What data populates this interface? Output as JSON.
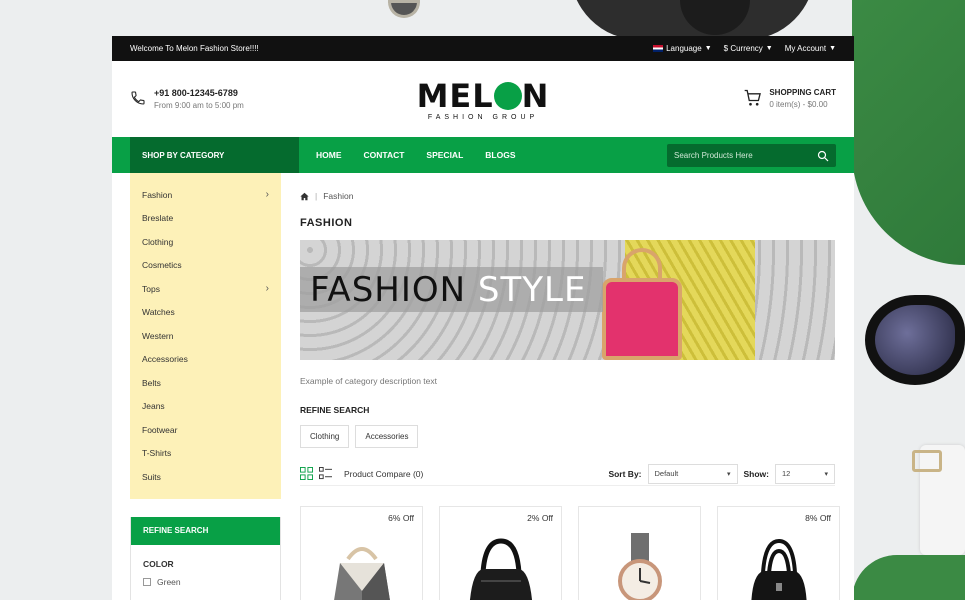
{
  "topbar": {
    "welcome": "Welcome To Melon Fashion Store!!!!",
    "language": "Language",
    "currency": "$ Currency",
    "account": "My Account"
  },
  "header": {
    "phone": "+91 800-12345-6789",
    "hours": "From 9:00 am to 5:00 pm",
    "logo_pre": "MEL",
    "logo_post": "N",
    "logo_sub": "FASHION GROUP",
    "cart_title": "SHOPPING CART",
    "cart_summary": "0 item(s) - $0.00"
  },
  "nav": {
    "category_button": "SHOP BY CATEGORY",
    "links": [
      "HOME",
      "CONTACT",
      "SPECIAL",
      "BLOGS"
    ],
    "search_placeholder": "Search Products Here"
  },
  "sidebar": {
    "categories": [
      {
        "label": "Fashion",
        "has_sub": true
      },
      {
        "label": "Breslate",
        "has_sub": false
      },
      {
        "label": "Clothing",
        "has_sub": false
      },
      {
        "label": "Cosmetics",
        "has_sub": false
      },
      {
        "label": "Tops",
        "has_sub": true
      },
      {
        "label": "Watches",
        "has_sub": false
      },
      {
        "label": "Western",
        "has_sub": false
      },
      {
        "label": "Accessories",
        "has_sub": false
      },
      {
        "label": "Belts",
        "has_sub": false
      },
      {
        "label": "Jeans",
        "has_sub": false
      },
      {
        "label": "Footwear",
        "has_sub": false
      },
      {
        "label": "T-Shirts",
        "has_sub": false
      },
      {
        "label": "Suits",
        "has_sub": false
      }
    ],
    "refine_title": "REFINE SEARCH",
    "color_label": "COLOR",
    "color_options": [
      "Green"
    ]
  },
  "main": {
    "breadcrumb": "Fashion",
    "title": "FASHION",
    "banner_word1": "FASHION",
    "banner_word2": "STYLE",
    "description": "Example of category description text",
    "refine_title": "REFINE SEARCH",
    "refine_chips": [
      "Clothing",
      "Accessories"
    ],
    "compare": "Product Compare (0)",
    "sort_label": "Sort By:",
    "sort_value": "Default",
    "show_label": "Show:",
    "show_value": "12",
    "products": [
      {
        "discount": "6% Off",
        "kind": "handbag-grey"
      },
      {
        "discount": "2% Off",
        "kind": "handbag-black"
      },
      {
        "discount": "",
        "kind": "watch"
      },
      {
        "discount": "8% Off",
        "kind": "handbag-black2"
      }
    ]
  },
  "colors": {
    "brand_green": "#08a046",
    "dark_green": "#056b2e",
    "category_bg": "#fdf1b8",
    "topbar_bg": "#111111"
  }
}
